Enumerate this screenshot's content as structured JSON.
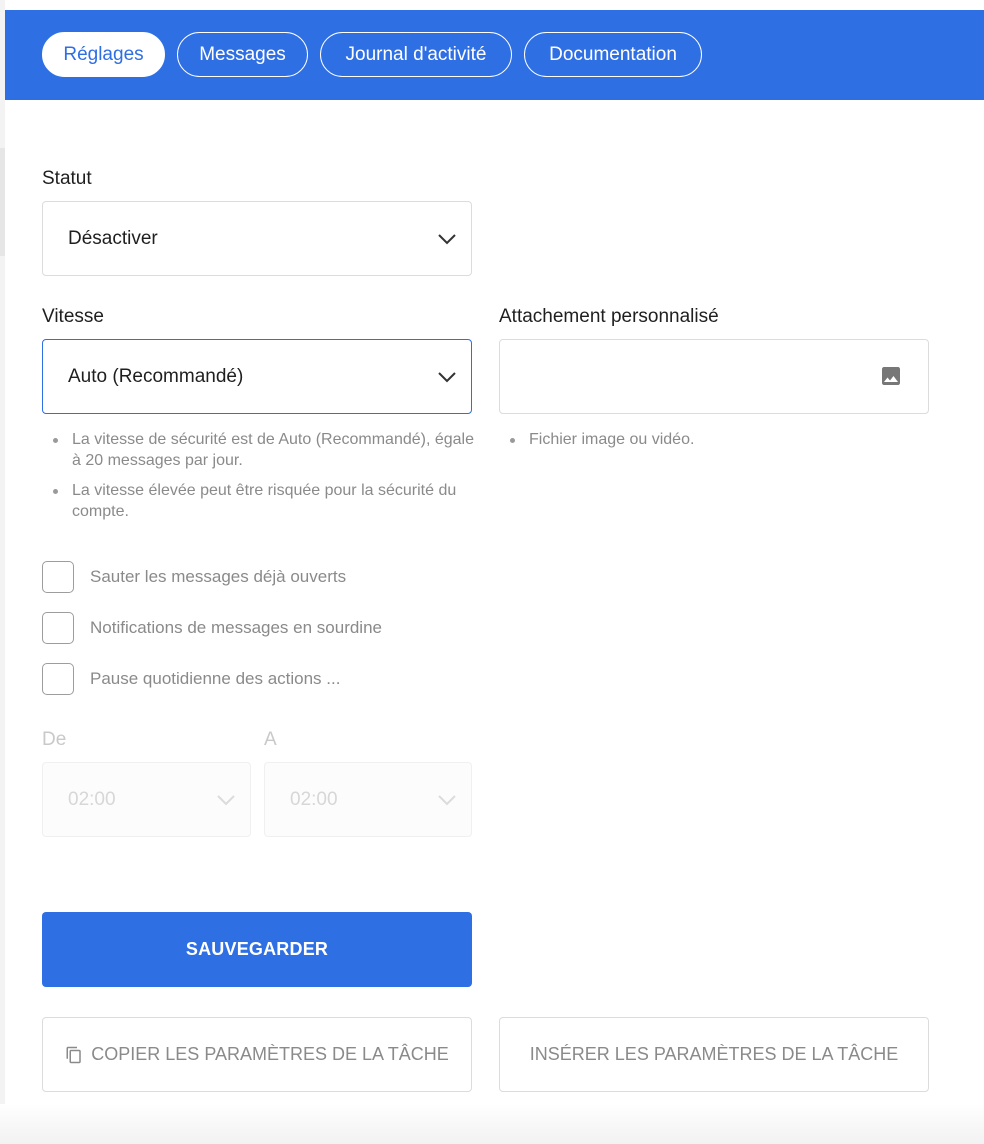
{
  "tabs": [
    {
      "label": "Réglages",
      "active": true
    },
    {
      "label": "Messages",
      "active": false
    },
    {
      "label": "Journal d'activité",
      "active": false
    },
    {
      "label": "Documentation",
      "active": false
    }
  ],
  "status": {
    "label": "Statut",
    "value": "Désactiver"
  },
  "speed": {
    "label": "Vitesse",
    "value": "Auto (Recommandé)",
    "hints": [
      "La vitesse de sécurité est de Auto (Recommandé), égale à 20 messages par jour.",
      "La vitesse élevée peut être risquée pour la sécurité du compte."
    ]
  },
  "attachment": {
    "label": "Attachement personnalisé",
    "hint": "Fichier image ou vidéo.",
    "icon": "image-icon"
  },
  "checkboxes": [
    {
      "label": "Sauter les messages déjà ouverts",
      "checked": false
    },
    {
      "label": "Notifications de messages en sourdine",
      "checked": false
    },
    {
      "label": "Pause quotidienne des actions ...",
      "checked": false
    }
  ],
  "schedule": {
    "from_label": "De",
    "from_value": "02:00",
    "to_label": "A",
    "to_value": "02:00"
  },
  "buttons": {
    "save": "SAUVEGARDER",
    "copy": "COPIER LES PARAMÈTRES DE LA TÂCHE",
    "insert": "INSÉRER LES PARAMÈTRES DE LA TÂCHE"
  },
  "colors": {
    "accent": "#2f6fe4",
    "muted_text": "#8a8a8a",
    "border": "#dcdcdc"
  }
}
